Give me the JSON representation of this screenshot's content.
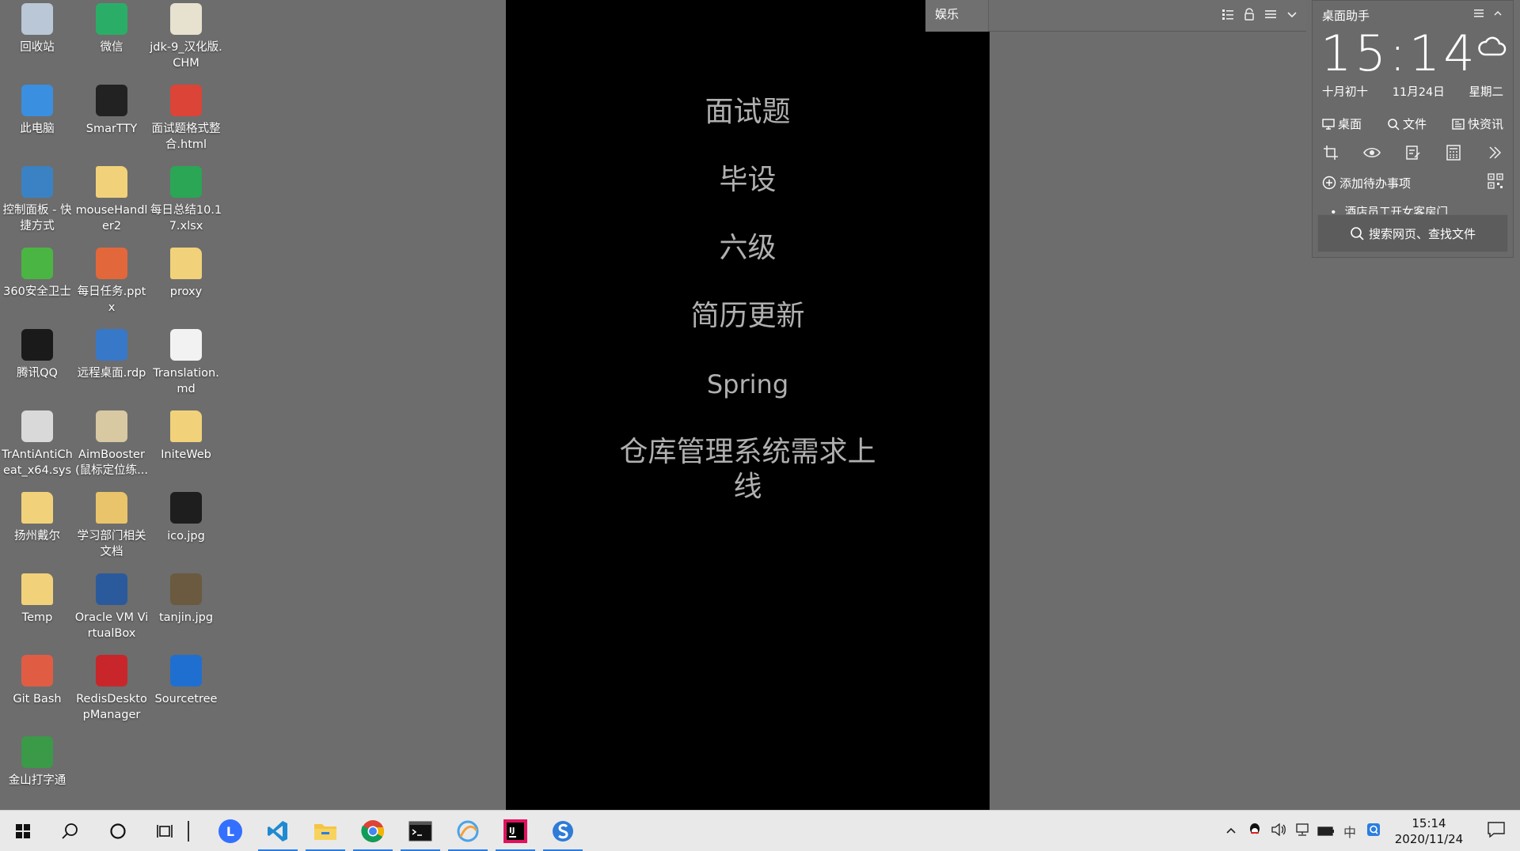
{
  "desktop": {
    "icons": [
      {
        "label": "回收站",
        "icon": "recycle-bin-icon",
        "color": "#b9c7d6"
      },
      {
        "label": "微信",
        "icon": "wechat-icon",
        "color": "#2aae67"
      },
      {
        "label": "jdk-9_汉化版.CHM",
        "icon": "chm-help-icon",
        "color": "#e7e2cf"
      },
      {
        "label": "此电脑",
        "icon": "this-pc-icon",
        "color": "#3a8fe0"
      },
      {
        "label": "SmarTTY",
        "icon": "terminal-icon",
        "color": "#222222"
      },
      {
        "label": "面试题格式整合.html",
        "icon": "chrome-icon",
        "color": "#db4437"
      },
      {
        "label": "控制面板 - 快捷方式",
        "icon": "control-panel-icon",
        "color": "#3b82c4"
      },
      {
        "label": "mouseHandler2",
        "icon": "folder-icon",
        "color": "#f1d27a"
      },
      {
        "label": "每日总结10.17.xlsx",
        "icon": "spreadsheet-icon",
        "color": "#2aa655"
      },
      {
        "label": "360安全卫士",
        "icon": "360-security-icon",
        "color": "#4bb543"
      },
      {
        "label": "每日任务.pptx",
        "icon": "presentation-icon",
        "color": "#e2673b"
      },
      {
        "label": "proxy",
        "icon": "folder-icon",
        "color": "#f1d27a"
      },
      {
        "label": "腾讯QQ",
        "icon": "qq-penguin-icon",
        "color": "#1a1a1a"
      },
      {
        "label": "远程桌面.rdp",
        "icon": "remote-desktop-icon",
        "color": "#3878c9"
      },
      {
        "label": "Translation.md",
        "icon": "markdown-icon",
        "color": "#f2f2f2"
      },
      {
        "label": "TrAntiAntiCheat_x64.sys",
        "icon": "system-file-icon",
        "color": "#d9d9d9"
      },
      {
        "label": "AimBooster(鼠标定位练...",
        "icon": "flash-file-icon",
        "color": "#d8c9a3"
      },
      {
        "label": "IniteWeb",
        "icon": "folder-icon",
        "color": "#f1d27a"
      },
      {
        "label": "扬州戴尔",
        "icon": "folder-icon",
        "color": "#f1d27a"
      },
      {
        "label": "学习部门相关文档",
        "icon": "folder-documents-icon",
        "color": "#e9c46a"
      },
      {
        "label": "ico.jpg",
        "icon": "image-file-icon",
        "color": "#1e1e1e"
      },
      {
        "label": "Temp",
        "icon": "folder-icon",
        "color": "#f1d27a"
      },
      {
        "label": "Oracle VM VirtualBox",
        "icon": "virtualbox-icon",
        "color": "#2b5a9c"
      },
      {
        "label": "tanjin.jpg",
        "icon": "photo-file-icon",
        "color": "#6b5a3f"
      },
      {
        "label": "Git Bash",
        "icon": "git-bash-icon",
        "color": "#e05d44"
      },
      {
        "label": "RedisDesktopManager",
        "icon": "redis-icon",
        "color": "#c8262a"
      },
      {
        "label": "Sourcetree",
        "icon": "sourcetree-icon",
        "color": "#1f6fd1"
      },
      {
        "label": "金山打字通",
        "icon": "typing-tutor-icon",
        "color": "#3a9a48"
      }
    ]
  },
  "note": {
    "items": [
      "面试题",
      "毕设",
      "六级",
      "简历更新",
      "Spring",
      "仓库管理系统需求上线"
    ]
  },
  "entertainment_bar": {
    "title": "娱乐",
    "tools": [
      "list-view-icon",
      "lock-icon",
      "menu-icon",
      "chevron-down-icon"
    ]
  },
  "assistant": {
    "title": "桌面助手",
    "time": "15:14",
    "lunar_date": "十月初十",
    "date": "11月24日",
    "weekday": "星期二",
    "quick_links": [
      "桌面",
      "文件",
      "快资讯"
    ],
    "add_todo": "添加待办事项",
    "todos": [
      "酒店员工开女客房门"
    ],
    "search_placeholder": "搜索网页、查找文件"
  },
  "taskbar": {
    "apps": [
      {
        "name": "start-button",
        "icon": "windows-logo-icon"
      },
      {
        "name": "search-button",
        "icon": "search-icon"
      },
      {
        "name": "cortana-button",
        "icon": "cortana-circle-icon"
      },
      {
        "name": "task-view-button",
        "icon": "task-view-icon"
      },
      {
        "name": "app-lark",
        "icon": "lark-icon",
        "color": "#3370ff"
      },
      {
        "name": "app-vscode",
        "icon": "vscode-icon",
        "color": "#1f8ad2"
      },
      {
        "name": "app-file-explorer",
        "icon": "folder-icon",
        "color": "#f4c542"
      },
      {
        "name": "app-chrome",
        "icon": "chrome-icon",
        "color": "#db4437"
      },
      {
        "name": "app-terminal",
        "icon": "terminal-icon",
        "color": "#111111"
      },
      {
        "name": "app-browser",
        "icon": "browser-icon",
        "color": "#4aa3e8"
      },
      {
        "name": "app-intellij",
        "icon": "intellij-icon",
        "color": "#e0115f"
      },
      {
        "name": "app-sogou",
        "icon": "sogou-icon",
        "color": "#2f7bd8"
      }
    ],
    "tray_time": "15:14",
    "tray_date": "2020/11/24",
    "ime_label": "中"
  }
}
